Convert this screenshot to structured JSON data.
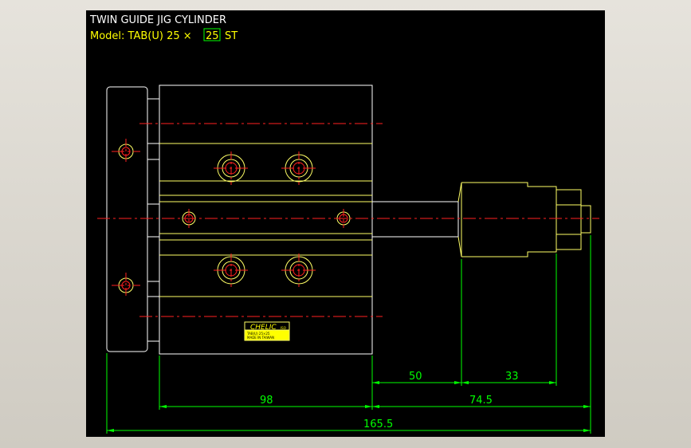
{
  "drawing": {
    "title": "TWIN  GUIDE  JIG  CYLINDER",
    "model_prefix": "Model:  TAB(U) 25 ×",
    "model_stroke": "25",
    "model_suffix": "ST",
    "brand": "CHELIC",
    "brand_tag": "ISO",
    "label_line1": "TAB(U) 25×25",
    "label_line2": "MADE IN TAIWAN",
    "dimensions": {
      "d50": "50",
      "d33": "33",
      "d98": "98",
      "d74_5": "74.5",
      "d165_5": "165.5"
    }
  },
  "colors": {
    "background": "#000000",
    "outline": "#ffffff",
    "body_lines": "#ffff66",
    "centerline": "#ff2020",
    "dimension": "#00ff00",
    "title_text": "#ffffff",
    "model_text": "#ffff00"
  }
}
